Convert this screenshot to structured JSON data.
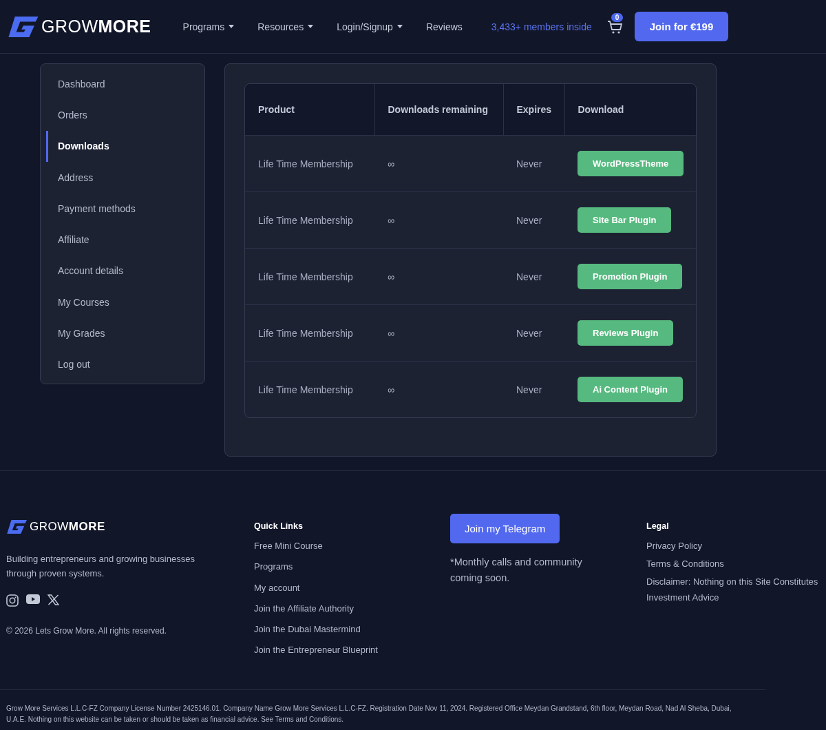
{
  "header": {
    "logo": "GROW**MORE**",
    "nav": [
      {
        "label": "Programs",
        "dropdown": true
      },
      {
        "label": "Resources",
        "dropdown": true
      },
      {
        "label": "Login/Signup",
        "dropdown": true
      },
      {
        "label": "Reviews",
        "dropdown": false
      }
    ],
    "members": "3,433+ members inside",
    "cart_count": "0",
    "join_button": "Join for €199"
  },
  "sidebar": {
    "items": [
      {
        "label": "Dashboard",
        "selected": false
      },
      {
        "label": "Orders",
        "selected": false
      },
      {
        "label": "Downloads",
        "selected": true
      },
      {
        "label": "Address",
        "selected": false
      },
      {
        "label": "Payment methods",
        "selected": false
      },
      {
        "label": "Affiliate",
        "selected": false
      },
      {
        "label": "Account details",
        "selected": false
      },
      {
        "label": "My Courses",
        "selected": false
      },
      {
        "label": "My Grades",
        "selected": false
      },
      {
        "label": "Log out",
        "selected": false
      }
    ]
  },
  "table": {
    "columns": [
      "Product",
      "Downloads remaining",
      "Expires",
      "Download"
    ],
    "rows": [
      {
        "product": "Life Time Membership",
        "remaining": "∞",
        "expires": "Never",
        "download": "WordPressTheme"
      },
      {
        "product": "Life Time Membership",
        "remaining": "∞",
        "expires": "Never",
        "download": "Site Bar Plugin"
      },
      {
        "product": "Life Time Membership",
        "remaining": "∞",
        "expires": "Never",
        "download": "Promotion Plugin"
      },
      {
        "product": "Life Time Membership",
        "remaining": "∞",
        "expires": "Never",
        "download": "Reviews Plugin"
      },
      {
        "product": "Life Time Membership",
        "remaining": "∞",
        "expires": "Never",
        "download": "Ai Content Plugin"
      }
    ]
  },
  "footer": {
    "logo": "GROW**MORE**",
    "tagline": "Building entrepreneurs and growing businesses through proven systems.",
    "copyright": "© 2026 Lets Grow More. All rights reserved.",
    "quick_links": {
      "title": "Quick Links",
      "links": [
        "Free Mini Course",
        "Programs",
        "My account",
        "Join the Affiliate Authority",
        "Join the Dubai Mastermind",
        "Join the Entrepreneur Blueprint"
      ]
    },
    "telegram_button": "Join my Telegram",
    "telegram_note": "*Monthly calls and community coming soon.",
    "legal": {
      "title": "Legal",
      "links": [
        "Privacy Policy",
        "Terms & Conditions",
        "Disclaimer: Nothing on this Site Constitutes Investment Advice"
      ]
    },
    "legal_notice": "Grow More Services L.L.C-FZ Company License Number 2425146.01. Company Name Grow More Services L.L.C-FZ. Registration Date Nov 11, 2024. Registered Office Meydan Grandstand, 6th floor, Meydan Road, Nad Al Sheba, Dubai, U.A.E. Nothing on this website can be taken or should be taken as financial advice. See Terms and Conditions."
  }
}
